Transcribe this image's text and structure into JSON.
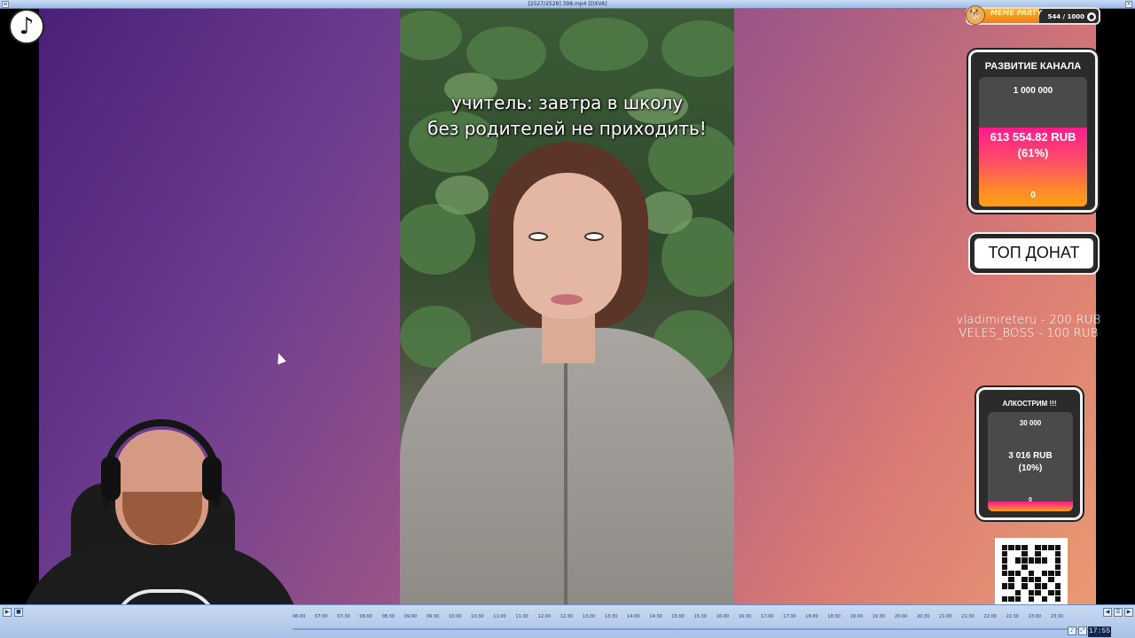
{
  "window": {
    "title": "[2527/2528] 398.mp4 [DXVA]"
  },
  "video": {
    "caption_line1": "учитель: завтра в школу",
    "caption_line2": "без родителей не приходить!"
  },
  "meme_party": {
    "title": "MEME PARTY",
    "count": "544 / 1000",
    "progress": 0.544,
    "icon": "coin-icon"
  },
  "channel_goal": {
    "title": "РАЗВИТИЕ КАНАЛА",
    "max": "1 000 000",
    "current": "613 554.82 RUB",
    "percent_label": "(61%)",
    "min": "0",
    "progress": 0.61
  },
  "top_donat": {
    "label": "ТОП ДОНАТ"
  },
  "donors": [
    "vladimireteru - 200 RUB",
    "VELES_BOSS - 100 RUB"
  ],
  "alco_goal": {
    "title": "АЛКОСТРИМ !!!",
    "max": "30 000",
    "current": "3 016 RUB",
    "percent_label": "(10%)",
    "min": "0",
    "progress": 0.1
  },
  "cam": {
    "shirt_text": "PUNK ROCK"
  },
  "player": {
    "time": "17:55",
    "ticks": [
      "06:00",
      "07:00",
      "07:30",
      "08:00",
      "08:30",
      "09:00",
      "09:30",
      "10:00",
      "10:30",
      "11:00",
      "11:30",
      "12:00",
      "12:30",
      "13:00",
      "13:30",
      "14:00",
      "14:30",
      "15:00",
      "15:30",
      "16:00",
      "16:30",
      "17:00",
      "17:30",
      "18:00",
      "18:30",
      "19:00",
      "19:30",
      "20:00",
      "20:30",
      "21:00",
      "21:30",
      "22:00",
      "22:30",
      "23:00",
      "23:30"
    ]
  },
  "colors": {
    "goal_fill_top": "#ff1a8c",
    "goal_fill_bottom": "#ffa118",
    "bg_left": "#4a2178",
    "bg_right": "#e99a72"
  }
}
